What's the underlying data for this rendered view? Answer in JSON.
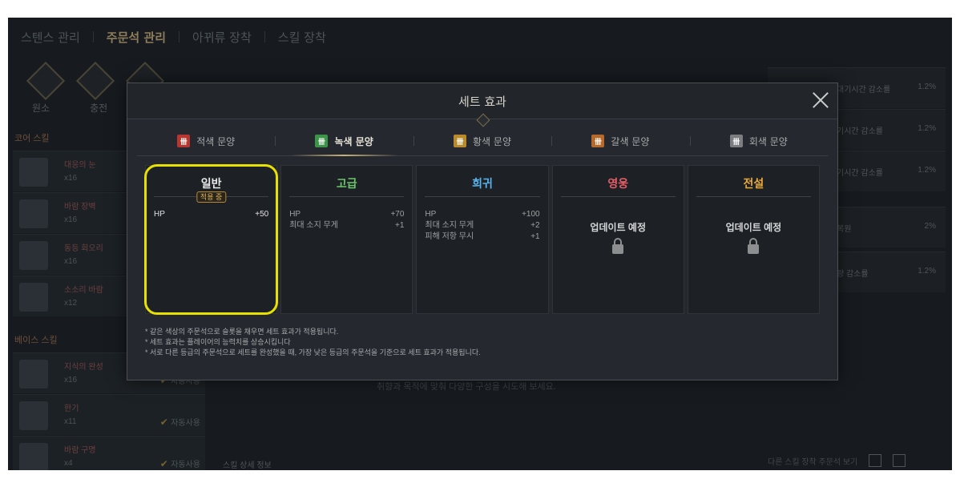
{
  "background": {
    "tabs": [
      "스텐스 관리",
      "주문석 관리",
      "아뀌류 장착",
      "스킬 장착"
    ],
    "icon_labels": [
      "원소",
      "충전"
    ],
    "sections": {
      "core": "코어 스킬",
      "base": "베이스 스킬"
    },
    "core_skills": [
      {
        "name": "대응의 눈",
        "count": "x16"
      },
      {
        "name": "바람 장벽",
        "count": "x16"
      },
      {
        "name": "동등 회오리",
        "count": "x16"
      },
      {
        "name": "소소리 바람",
        "count": "x12"
      }
    ],
    "base_skills": [
      {
        "name": "지식의 완성",
        "count": "x16",
        "auto": "자동사용"
      },
      {
        "name": "한기",
        "count": "x11",
        "auto": "자동사용"
      },
      {
        "name": "바람 구명",
        "count": "x4",
        "auto": "자동사용"
      }
    ],
    "right_rows": [
      {
        "text": "대기시간 감소률",
        "pct": "1.2%"
      },
      {
        "text": "기시간 감소률",
        "pct": "1.2%"
      },
      {
        "text": "기시간 감소률",
        "pct": "1.2%"
      },
      {
        "text": "복원",
        "pct": "2%"
      },
      {
        "text": "량 감소률",
        "pct": "1.2%"
      }
    ],
    "center_msg": "취향과 목적에 맞춰 다양한 구성을 시도해 보세요.",
    "bottom_left": "스킬 상세 정보",
    "bottom_right": "다른 스킬 장착 주문석 보기"
  },
  "modal": {
    "title": "세트 효과",
    "tabs": [
      {
        "label": "적색 문양",
        "color": "#b7362f",
        "glyph": "卌"
      },
      {
        "label": "녹색 문양",
        "color": "#3b9447",
        "glyph": "卌"
      },
      {
        "label": "황색 문양",
        "color": "#b88a2c",
        "glyph": "卌"
      },
      {
        "label": "갈색 문양",
        "color": "#b56a2b",
        "glyph": "卌"
      },
      {
        "label": "회색 문양",
        "color": "#7b7d80",
        "glyph": "卌"
      }
    ],
    "active_tab": 1,
    "tiers": [
      {
        "name": "일반",
        "badge": "적용 중",
        "stats": [
          {
            "label": "HP",
            "value": "+50"
          }
        ]
      },
      {
        "name": "고급",
        "stats": [
          {
            "label": "HP",
            "value": "+70"
          },
          {
            "label": "최대 소지 무게",
            "value": "+1"
          }
        ]
      },
      {
        "name": "희귀",
        "stats": [
          {
            "label": "HP",
            "value": "+100"
          },
          {
            "label": "최대 소지 무게",
            "value": "+2"
          },
          {
            "label": "피해 저항 무시",
            "value": "+1"
          }
        ]
      },
      {
        "name": "영웅",
        "locked_text": "업데이트 예정"
      },
      {
        "name": "전설",
        "locked_text": "업데이트 예정"
      }
    ],
    "notes": [
      "* 같은 색상의 주문석으로 슬롯을 채우면 세트 효과가 적용됩니다.",
      "* 세트 효과는 플레이어의 능력치를 상승시킵니다",
      "* 서로 다른 등급의 주문석으로 세트를 완성했을 때, 가장 낮은 등급의 주문석을 기준으로 세트 효과가 적용됩니다."
    ]
  }
}
